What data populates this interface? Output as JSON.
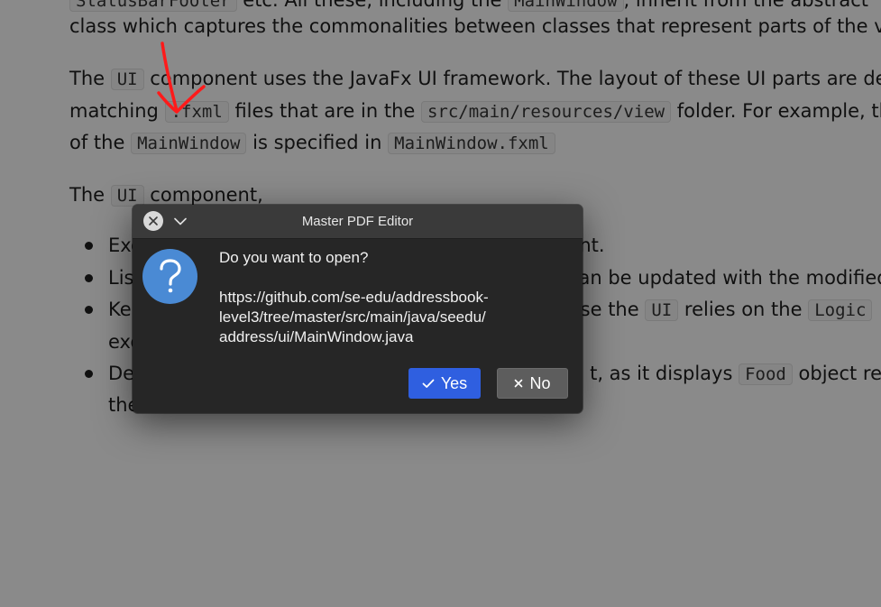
{
  "document": {
    "line1": {
      "c1": "StatusBarFooter",
      "t1": " etc. All these, including the ",
      "c2": "MainWindow",
      "t2": ", inherit from the abstract "
    },
    "line2": {
      "t1": "class which captures the commonalities between classes that represent parts of the visib"
    },
    "line3": {
      "t1": "The ",
      "c1": "UI",
      "t2": " component uses the JavaFx UI framework. The layout of these UI parts are defin"
    },
    "line4": {
      "t1": "matching ",
      "c1": ".fxml",
      "t2": " files that are in the ",
      "c2": "src/main/resources/view",
      "t3": " folder. For example, th"
    },
    "line5": {
      "t1": "of the ",
      "c1": "MainWindow",
      "t2": " is specified in ",
      "c2": "MainWindow.fxml"
    },
    "line6": {
      "t1": "The ",
      "c1": "UI",
      "t2": " component,"
    },
    "bullets": [
      {
        "t1": "Exe",
        "t2": "ment."
      },
      {
        "t1": "Lis",
        "t2": "an be updated with the modified"
      },
      {
        "t1": "Ke",
        "t2": "se the ",
        "c1": "UI",
        "t3": " relies on the ",
        "c2": "Logic"
      },
      {
        "t1": "De",
        "t2": "t, as it displays ",
        "c1": "Food",
        "t3": " object resi"
      }
    ],
    "bullet3_cont": "exe",
    "bullet4_cont": "the"
  },
  "dialog": {
    "title": "Master PDF Editor",
    "question": "Do you want to open?",
    "url": "https://github.com/se-edu/addressbook-level3/tree/master/src/main/java/seedu/address/ui/MainWindow.java",
    "yes_label": "Yes",
    "no_label": "No",
    "yes_color": "#2f5fe0",
    "no_color": "#5d5d5d",
    "icons": {
      "close": "close-icon",
      "menu": "chevron-down-icon",
      "question": "question-icon",
      "yes": "check-icon",
      "no": "x-icon"
    }
  },
  "annotation": {
    "color": "#ff1a1a",
    "shape": "arrow-icon"
  }
}
